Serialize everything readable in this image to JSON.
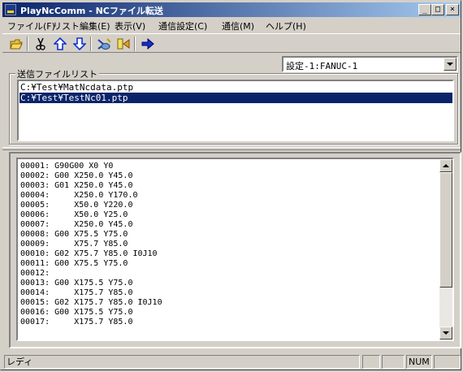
{
  "window": {
    "title": "PlayNcComm - NCファイル転送",
    "minimize": "_",
    "maximize": "□",
    "close": "×"
  },
  "menu": [
    {
      "label": "ファイル(F)"
    },
    {
      "label": "リスト編集(E)"
    },
    {
      "label": "表示(V)"
    },
    {
      "label": "通信設定(C)"
    },
    {
      "label": "通信(M)"
    },
    {
      "label": "ヘルプ(H)"
    }
  ],
  "toolbar": {
    "buttons": [
      "open-folder-icon",
      "cut-icon",
      "up-arrow-icon",
      "down-arrow-icon",
      "receive-icon",
      "send-icon",
      "run-icon"
    ],
    "colors": {
      "folder": "#c8a000",
      "arrow": "#1030d0",
      "run": "#1030d0"
    }
  },
  "settings_combo": {
    "value": "設定-1:FANUC-1"
  },
  "send_file_list": {
    "legend": "送信ファイルリスト",
    "items": [
      {
        "path": "C:¥Test¥MatNcdata.ptp",
        "selected": false
      },
      {
        "path": "C:¥Test¥TestNc01.ptp",
        "selected": true
      }
    ]
  },
  "nc_preview": {
    "lines": [
      "00001: G90G00 X0 Y0",
      "00002: G00 X250.0 Y45.0",
      "00003: G01 X250.0 Y45.0",
      "00004:     X250.0 Y170.0",
      "00005:     X50.0 Y220.0",
      "00006:     X50.0 Y25.0",
      "00007:     X250.0 Y45.0",
      "00008: G00 X75.5 Y75.0",
      "00009:     X75.7 Y85.0",
      "00010: G02 X75.7 Y85.0 I0J10",
      "00011: G00 X75.5 Y75.0",
      "00012:",
      "00013: G00 X175.5 Y75.0",
      "00014:     X175.7 Y85.0",
      "00015: G02 X175.7 Y85.0 I0J10",
      "00016: G00 X175.5 Y75.0",
      "00017:     X175.7 Y85.0"
    ]
  },
  "status": {
    "text": "レディ",
    "num": "NUM"
  }
}
